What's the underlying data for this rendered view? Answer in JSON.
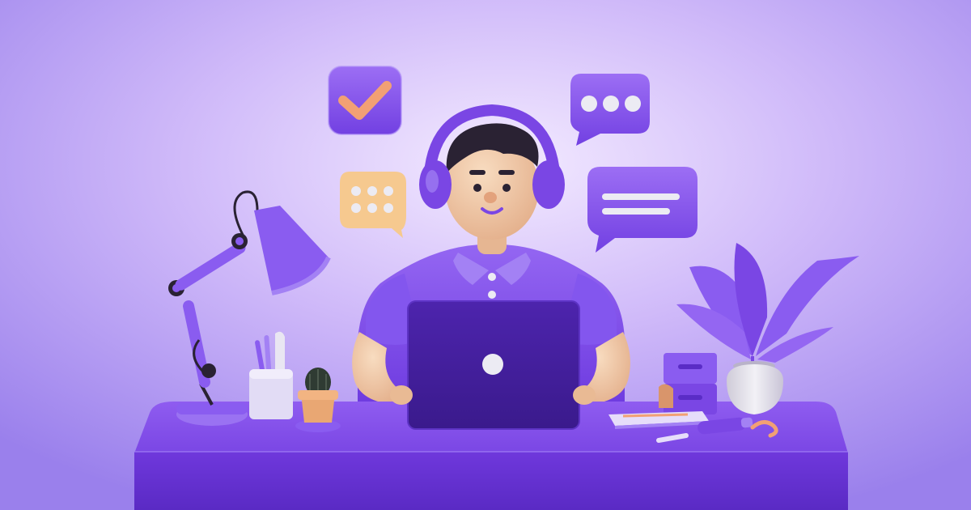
{
  "scene": {
    "palette": {
      "bg_center": "#efe4ff",
      "bg_mid": "#c8b0f8",
      "bg_edge": "#9d84ee",
      "purple": "#7b45e6",
      "purple_dark": "#5a2cc6",
      "purple_deep": "#43209b",
      "purple_light": "#a381f4",
      "skin": "#f3cfae",
      "skin_shade": "#dca985",
      "hair": "#2a2233",
      "orange": "#f2a074",
      "yellow": "#f6c98f",
      "white": "#ecebf3"
    },
    "icons": [
      "person-with-headphones",
      "laptop",
      "desk-lamp",
      "pen-holder",
      "cactus-pot",
      "checkmark-badge",
      "ellipsis-chat-bubble",
      "dots-grid-chat-bubble",
      "text-lines-chat-bubble",
      "potted-plant",
      "file-drawers",
      "notebook",
      "marker-pen"
    ]
  }
}
